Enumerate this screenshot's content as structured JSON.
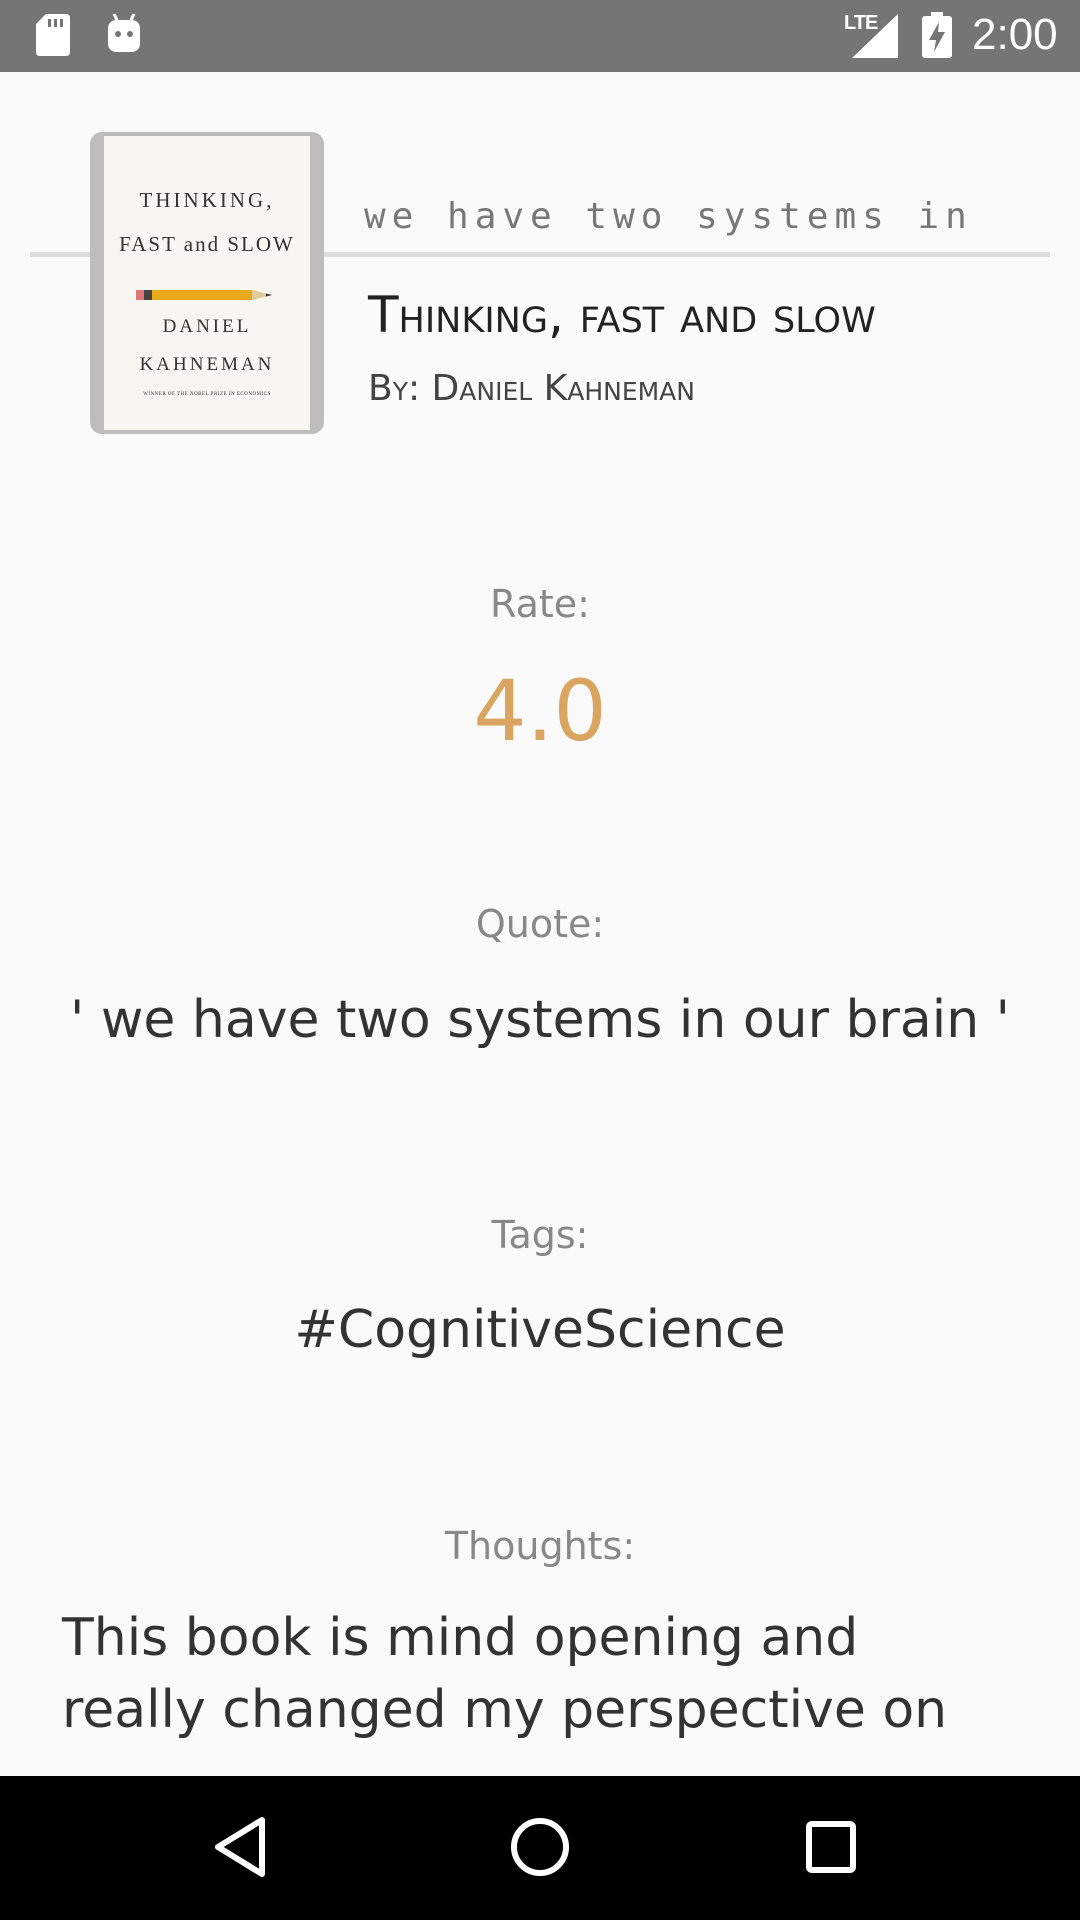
{
  "status_bar": {
    "network": "LTE",
    "time": "2:00",
    "icons": [
      "sd-card-icon",
      "android-icon",
      "signal-icon",
      "battery-charging-icon"
    ]
  },
  "book": {
    "cover": {
      "title_line_1": "THINKING,",
      "title_line_2": "FAST and SLOW",
      "author_line_1": "DANIEL",
      "author_line_2": "KAHNEMAN",
      "note": "WINNER OF THE NOBEL PRIZE IN ECONOMICS"
    },
    "quote_teaser": "we have two systems in",
    "title": "Thinking, fast and slow",
    "author": "By: Daniel Kahneman"
  },
  "rate": {
    "label": "Rate:",
    "value": "4.0"
  },
  "quote": {
    "label": "Quote:",
    "value": "' we have two systems in our brain '"
  },
  "tags": {
    "label": "Tags:",
    "value": "#CognitiveScience"
  },
  "thoughts": {
    "label": "Thoughts:",
    "line_1": "This book is mind opening and",
    "line_2": "really changed my perspective on"
  },
  "nav_bar": {
    "buttons": [
      "back-icon",
      "home-icon",
      "recents-icon"
    ]
  },
  "colors": {
    "status_bar": "#757575",
    "background": "#fafafa",
    "rate_accent": "#d9a560",
    "nav_bar": "#000000"
  }
}
